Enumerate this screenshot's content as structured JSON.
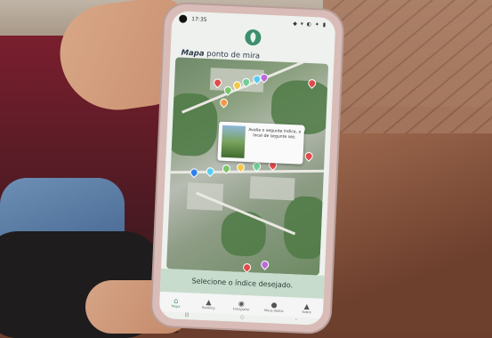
{
  "status_bar": {
    "time": "17:35",
    "icons": "◆ ▾ ◐ ✦ ▮"
  },
  "app": {
    "logo_text": "",
    "title_bold": "Mapa",
    "title_rest": " ponto de mira"
  },
  "popup": {
    "text": "Avalie o segunte índice, o local de segunte sez."
  },
  "banner": {
    "text": "Selecione o índice desejado."
  },
  "nav": [
    {
      "label": "Mapa",
      "icon": "⌂"
    },
    {
      "label": "Ranking",
      "icon": "▲"
    },
    {
      "label": "Fotografar",
      "icon": "◉"
    },
    {
      "label": "Meus dados",
      "icon": "●"
    },
    {
      "label": "Sobre",
      "icon": "▲"
    }
  ],
  "system_nav": {
    "recents": "|||",
    "home": "○",
    "back": "‹"
  },
  "colors": {
    "accent": "#3c8f6d",
    "banner": "#c7dccd"
  }
}
